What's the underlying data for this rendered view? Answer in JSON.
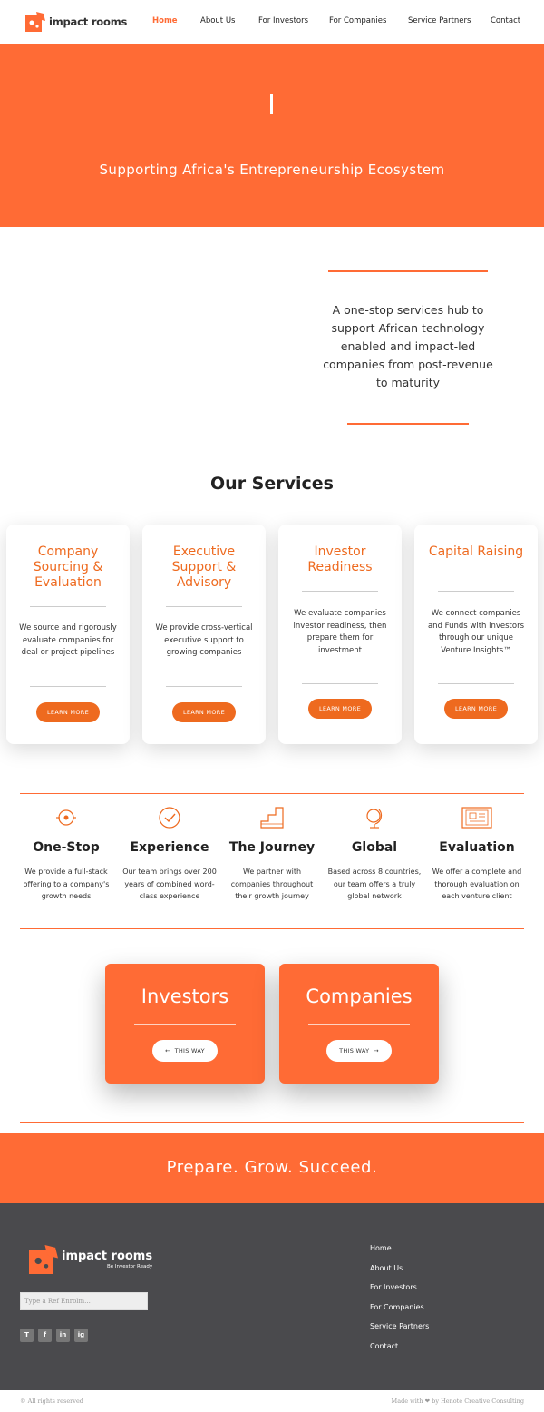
{
  "brand": {
    "name": "impact rooms",
    "tagline": "Be Investor Ready",
    "accent_color": "#ff6b35",
    "footer_bg": "#4a4a4d"
  },
  "nav": {
    "items": [
      {
        "label": "Home",
        "active": true
      },
      {
        "label": "About Us"
      },
      {
        "label": "For Investors"
      },
      {
        "label": "For Companies"
      },
      {
        "label": "Service Partners"
      },
      {
        "label": "Contact"
      }
    ]
  },
  "hero": {
    "tagline": "Supporting Africa's Entrepreneurship Ecosystem"
  },
  "intro": {
    "text": "A one-stop services hub to support African technology enabled and impact-led companies from post-revenue to maturity"
  },
  "services": {
    "title": "Our Services",
    "cards": [
      {
        "title": "Company Sourcing & Evaluation",
        "text": "We source and rigorously evaluate companies for deal or project pipelines",
        "button": "LEARN MORE"
      },
      {
        "title": "Executive Support & Advisory",
        "text": "We provide cross-vertical executive support to growing companies",
        "button": "LEARN MORE"
      },
      {
        "title": "Investor Readiness",
        "text": "We evaluate companies investor readiness, then prepare them for investment",
        "button": "LEARN MORE"
      },
      {
        "title": "Capital Raising",
        "text": "We connect companies and Funds with investors through our unique Venture Insights™",
        "button": "LEARN MORE"
      }
    ]
  },
  "features": [
    {
      "icon": "target-icon",
      "title": "One-Stop",
      "text": "We provide a full-stack offering to a company's growth needs"
    },
    {
      "icon": "check-circle-icon",
      "title": "Experience",
      "text": "Our team brings over 200 years of combined word-class experience"
    },
    {
      "icon": "stairs-icon",
      "title": "The Journey",
      "text": "We partner with companies throughout their growth journey"
    },
    {
      "icon": "globe-icon",
      "title": "Global",
      "text": "Based across 8 countries, our team offers a truly global network"
    },
    {
      "icon": "document-icon",
      "title": "Evaluation",
      "text": "We offer a complete and thorough evaluation on each venture client"
    }
  ],
  "cta": {
    "investors": {
      "title": "Investors",
      "button": "THIS WAY"
    },
    "companies": {
      "title": "Companies",
      "button": "THIS WAY"
    }
  },
  "slogan": "Prepare. Grow. Succeed.",
  "footer": {
    "search_placeholder": "Type a Ref Enrolm...",
    "social": [
      "T",
      "f",
      "in",
      "ig"
    ],
    "links": [
      "Home",
      "About Us",
      "For Investors",
      "For Companies",
      "Service Partners",
      "Contact"
    ],
    "copyright": "© All rights reserved",
    "made_with": "Made with ❤ by Henote Creative Consulting"
  }
}
